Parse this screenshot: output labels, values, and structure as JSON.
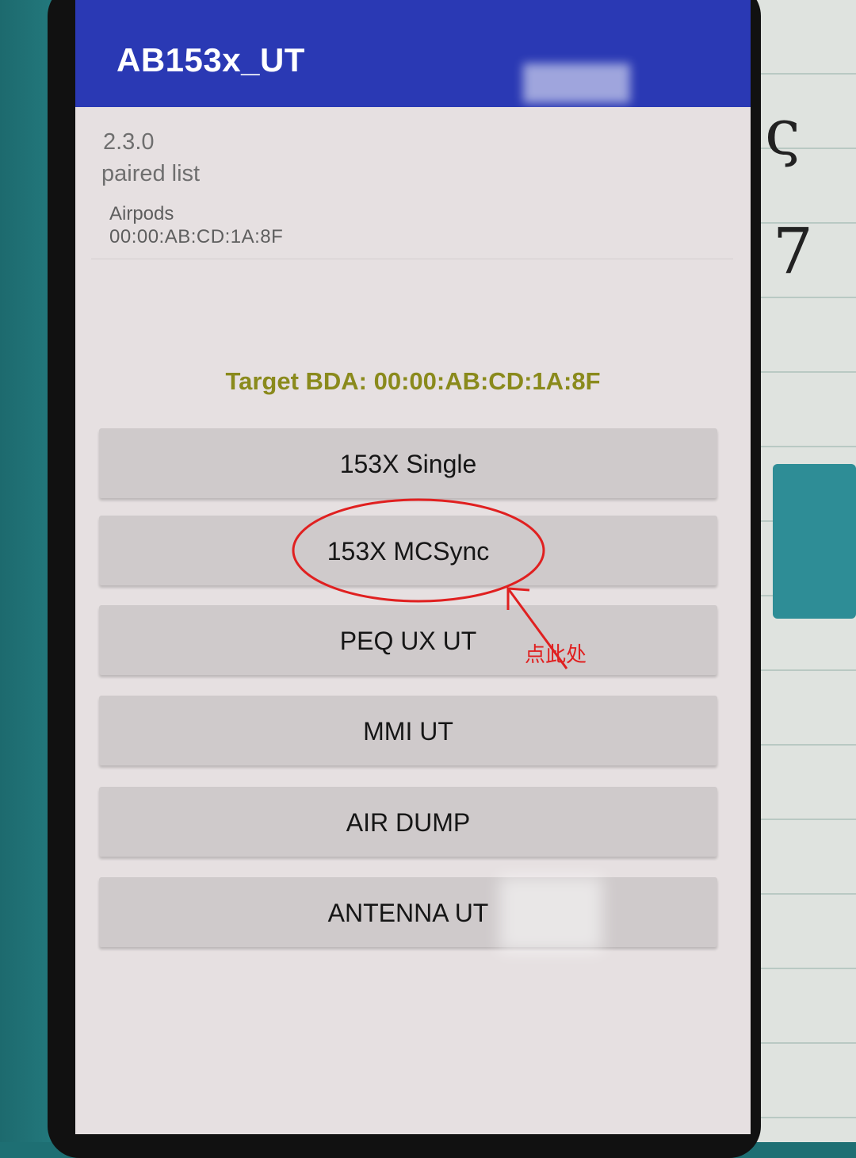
{
  "app": {
    "title": "AB153x_UT",
    "version": "2.3.0",
    "paired_list_label": "paired list",
    "paired_devices": [
      {
        "name": "Airpods",
        "address": "00:00:AB:CD:1A:8F"
      }
    ],
    "target_bda_text": "Target BDA: 00:00:AB:CD:1A:8F"
  },
  "menu": {
    "buttons": [
      {
        "label": "153X Single"
      },
      {
        "label": "153X MCSync"
      },
      {
        "label": "PEQ UX UT"
      },
      {
        "label": "MMI UT"
      },
      {
        "label": "AIR DUMP"
      },
      {
        "label": "ANTENNA UT"
      }
    ]
  },
  "annotation": {
    "label": "点此处",
    "color": "#e02020",
    "highlighted_button": "153X MCSync"
  },
  "colors": {
    "app_bar": "#2a39b4",
    "target_bda": "#8a8a1c",
    "button_bg": "#cfcacb",
    "screen_bg": "#e6e0e1"
  }
}
